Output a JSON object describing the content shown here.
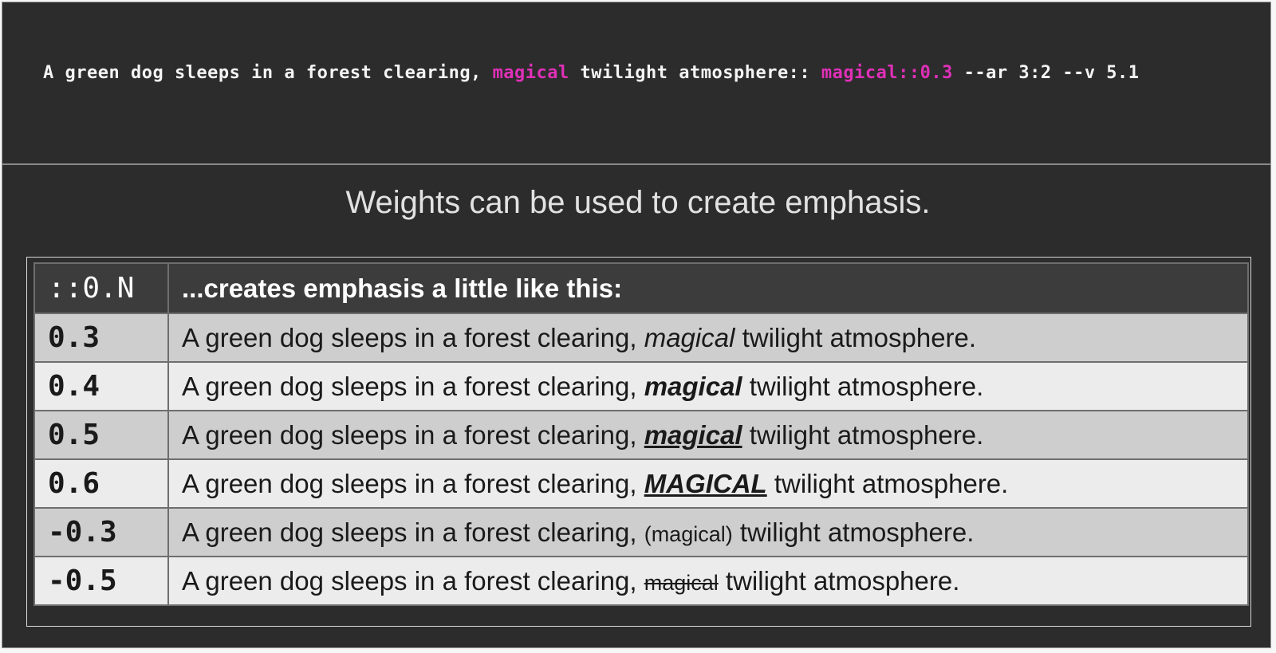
{
  "prompt": {
    "part1": "A green dog sleeps in a forest clearing, ",
    "highlight1": "magical",
    "part2": " twilight atmosphere:: ",
    "highlight2": "magical::0.3",
    "part3": " --ar 3:2 --v 5.1",
    "highlight_color": "#e030b8"
  },
  "heading": "Weights can be used to create emphasis.",
  "table": {
    "header": {
      "col1": "::0.N",
      "col2": "...creates emphasis a little like this:"
    },
    "rows": [
      {
        "weight": "0.3",
        "before": "A green dog sleeps in a forest clearing, ",
        "word": "magical",
        "after": " twilight atmosphere."
      },
      {
        "weight": "0.4",
        "before": "A green dog sleeps in a forest clearing, ",
        "word": "magical",
        "after": " twilight atmosphere."
      },
      {
        "weight": "0.5",
        "before": "A green dog sleeps in a forest clearing, ",
        "word": "magical",
        "after": " twilight atmosphere."
      },
      {
        "weight": "0.6",
        "before": "A green dog sleeps in a forest clearing, ",
        "word": "MAGICAL",
        "after": " twilight atmosphere."
      },
      {
        "weight": "-0.3",
        "before": "A green dog sleeps in a forest clearing, ",
        "word": "(magical)",
        "after": " twilight atmosphere."
      },
      {
        "weight": "-0.5",
        "before": "A green dog sleeps in a forest clearing, ",
        "word": "magical",
        "after": " twilight atmosphere."
      }
    ]
  }
}
